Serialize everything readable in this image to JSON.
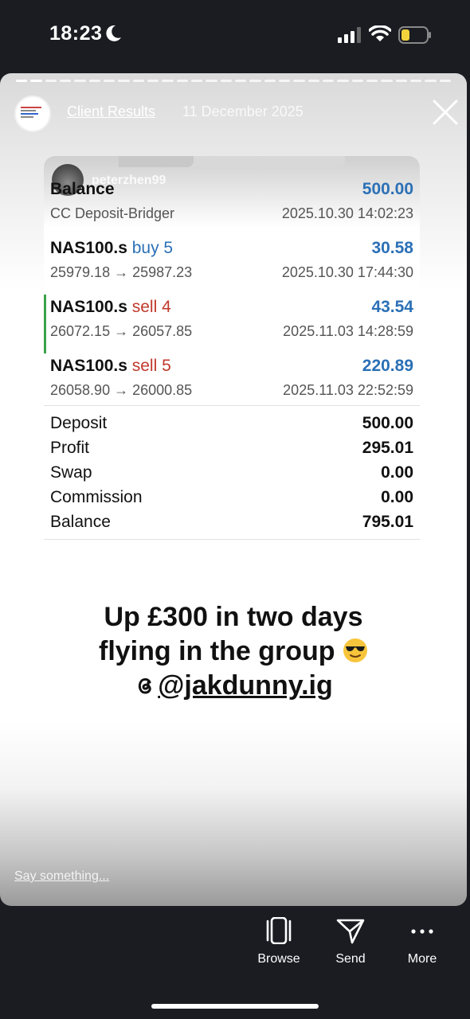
{
  "status_bar": {
    "time": "18:23"
  },
  "story": {
    "account_name": "Client Results",
    "date": "11 December 2025",
    "avatar_text": "£500 account",
    "reply_placeholder": "Say something...",
    "caption": {
      "line1": "Up £300 in two days",
      "line2": "flying in the group",
      "handle": "@jakdunny.ig"
    }
  },
  "embedded": {
    "overlay_username": "peterzhen99",
    "rows": [
      {
        "title": "Balance",
        "direction": "",
        "direction_type": "",
        "amount": "500.00",
        "detail": "CC Deposit-Bridger",
        "timestamp": "2025.10.30 14:02:23"
      },
      {
        "title": "NAS100.s",
        "direction": "buy 5",
        "direction_type": "buy",
        "amount": "30.58",
        "detail": "25979.18 → 25987.23",
        "timestamp": "2025.10.30 17:44:30"
      },
      {
        "title": "NAS100.s",
        "direction": "sell 4",
        "direction_type": "sell",
        "amount": "43.54",
        "detail": "26072.15 → 26057.85",
        "timestamp": "2025.11.03 14:28:59"
      },
      {
        "title": "NAS100.s",
        "direction": "sell 5",
        "direction_type": "sell",
        "amount": "220.89",
        "detail": "26058.90 → 26000.85",
        "timestamp": "2025.11.03 22:52:59"
      }
    ],
    "summary": [
      {
        "label": "Deposit",
        "value": "500.00"
      },
      {
        "label": "Profit",
        "value": "295.01"
      },
      {
        "label": "Swap",
        "value": "0.00"
      },
      {
        "label": "Commission",
        "value": "0.00"
      },
      {
        "label": "Balance",
        "value": "795.01"
      }
    ]
  },
  "actions": {
    "browse": "Browse",
    "send": "Send",
    "more": "More"
  },
  "colors": {
    "buy": "#2b70b6",
    "sell": "#c0392b",
    "accent_bar": "#3aa34a"
  }
}
